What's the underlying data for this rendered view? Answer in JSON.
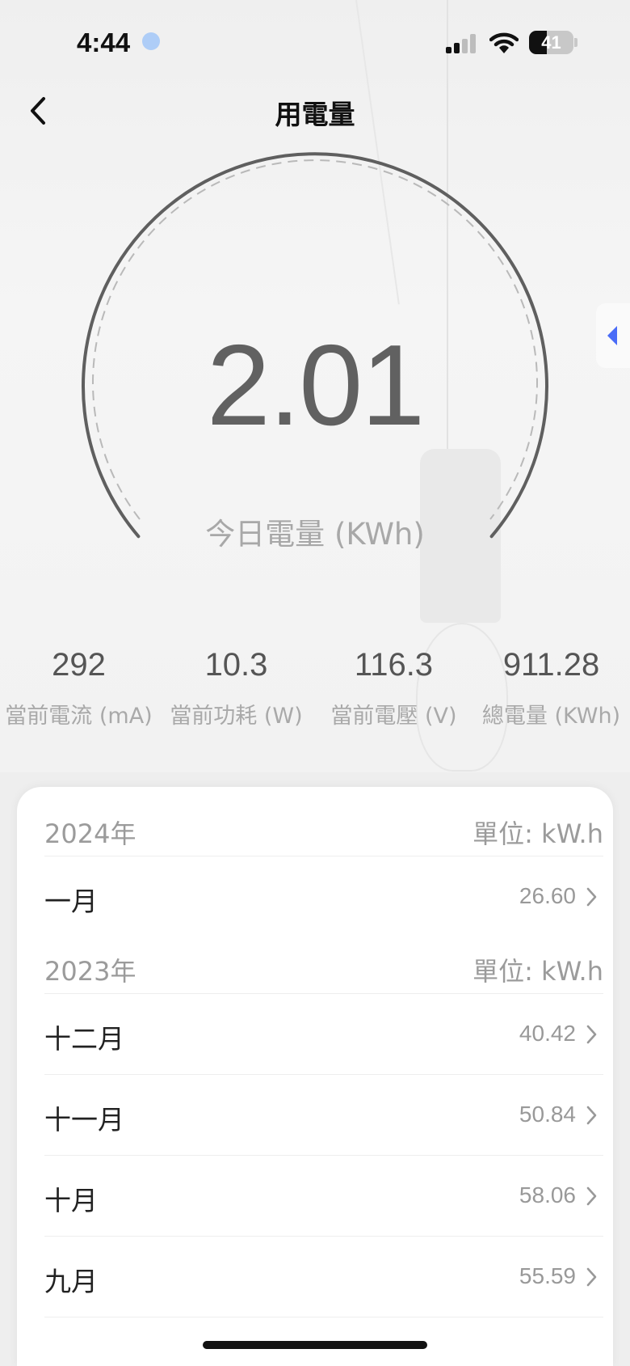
{
  "status_bar": {
    "time": "4:44",
    "battery": "41"
  },
  "header": {
    "title": "用電量"
  },
  "gauge": {
    "value": "2.01",
    "label": "今日電量 (KWh)"
  },
  "stats": [
    {
      "value": "292",
      "label": "當前電流 (mA)"
    },
    {
      "value": "10.3",
      "label": "當前功耗 (W)"
    },
    {
      "value": "116.3",
      "label": "當前電壓 (V)"
    },
    {
      "value": "911.28",
      "label": "總電量 (KWh)"
    }
  ],
  "history": {
    "y2024": {
      "year": "2024年",
      "unit": "單位: kW.h",
      "months": [
        {
          "month": "一月",
          "value": "26.60"
        }
      ]
    },
    "y2023": {
      "year": "2023年",
      "unit": "單位: kW.h",
      "months": [
        {
          "month": "十二月",
          "value": "40.42"
        },
        {
          "month": "十一月",
          "value": "50.84"
        },
        {
          "month": "十月",
          "value": "58.06"
        },
        {
          "month": "九月",
          "value": "55.59"
        }
      ]
    }
  },
  "colors": {
    "accent": "#4a6cf7",
    "gauge_stroke": "#5f5f5f"
  },
  "icons": {
    "back": "chevron-left-icon",
    "row": "chevron-right-icon"
  }
}
